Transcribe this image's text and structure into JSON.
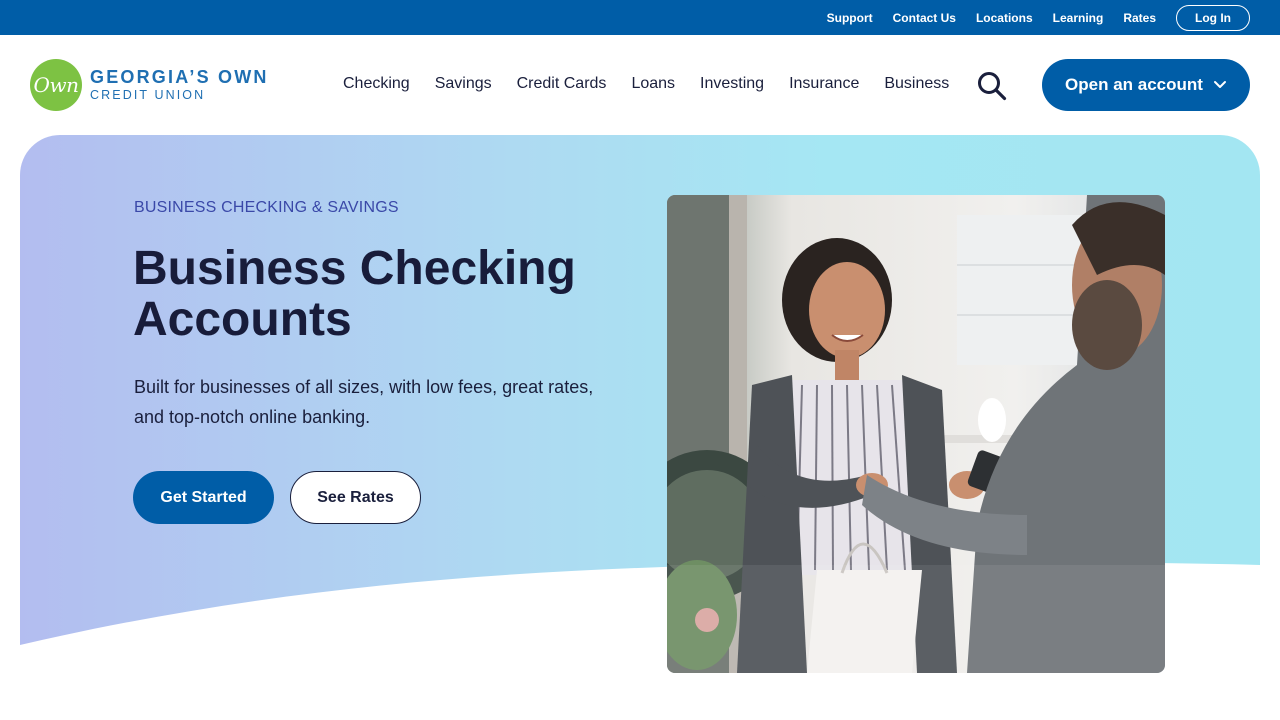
{
  "utility_nav": {
    "links": [
      "Support",
      "Contact Us",
      "Locations",
      "Learning",
      "Rates"
    ],
    "login_label": "Log In"
  },
  "brand": {
    "mark": "Own",
    "name_line1": "GEORGIA’S OWN",
    "name_line2": "CREDIT UNION",
    "green": "#7dc243",
    "blue": "#005da7"
  },
  "primary_nav": {
    "items": [
      "Checking",
      "Savings",
      "Credit Cards",
      "Loans",
      "Investing",
      "Insurance",
      "Business"
    ],
    "search_icon": "search-icon",
    "cta_label": "Open an account",
    "cta_icon": "chevron-down-icon"
  },
  "hero": {
    "eyebrow": "BUSINESS CHECKING & SAVINGS",
    "title": "Business Checking Accounts",
    "description": "Built for businesses of all sizes, with low fees, great rates, and top-notch online banking.",
    "primary_button": "Get Started",
    "secondary_button": "See Rates"
  }
}
